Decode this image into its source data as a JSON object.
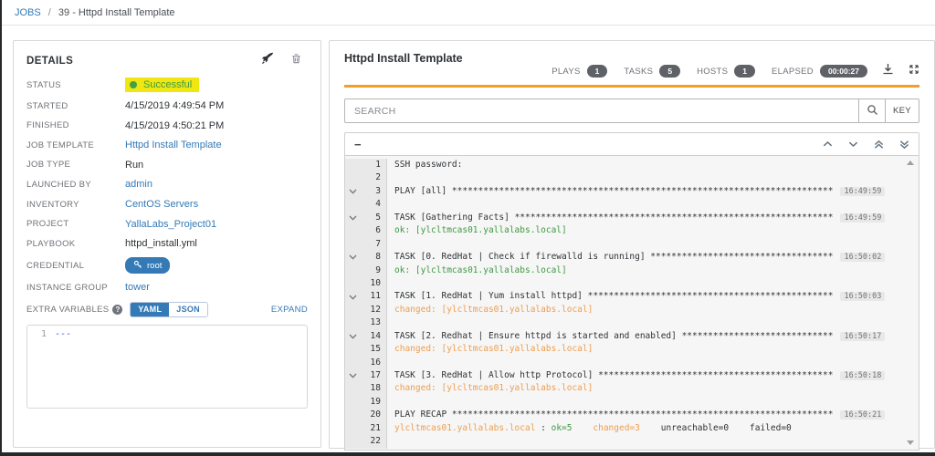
{
  "breadcrumb": {
    "root": "JOBS",
    "separator": "/",
    "current": "39 - Httpd Install Template"
  },
  "details": {
    "title": "DETAILS",
    "rows": [
      {
        "label": "STATUS",
        "value": "Successful",
        "type": "status"
      },
      {
        "label": "STARTED",
        "value": "4/15/2019 4:49:54 PM",
        "type": "text"
      },
      {
        "label": "FINISHED",
        "value": "4/15/2019 4:50:21 PM",
        "type": "text"
      },
      {
        "label": "JOB TEMPLATE",
        "value": "Httpd Install Template",
        "type": "link"
      },
      {
        "label": "JOB TYPE",
        "value": "Run",
        "type": "text"
      },
      {
        "label": "LAUNCHED BY",
        "value": "admin",
        "type": "link"
      },
      {
        "label": "INVENTORY",
        "value": "CentOS Servers",
        "type": "link"
      },
      {
        "label": "PROJECT",
        "value": "YallaLabs_Project01",
        "type": "link"
      },
      {
        "label": "PLAYBOOK",
        "value": "httpd_install.yml",
        "type": "text"
      },
      {
        "label": "CREDENTIAL",
        "value": "root",
        "type": "credential"
      },
      {
        "label": "INSTANCE GROUP",
        "value": "tower",
        "type": "link"
      }
    ],
    "extra_variables": {
      "label": "EXTRA VARIABLES",
      "yaml_label": "YAML",
      "json_label": "JSON",
      "expand_label": "EXPAND",
      "line_number": "1",
      "content": "---"
    }
  },
  "output": {
    "title": "Httpd Install Template",
    "stats": [
      {
        "label": "PLAYS",
        "value": "1"
      },
      {
        "label": "TASKS",
        "value": "5"
      },
      {
        "label": "HOSTS",
        "value": "1"
      },
      {
        "label": "ELAPSED",
        "value": "00:00:27"
      }
    ],
    "search": {
      "placeholder": "SEARCH",
      "key_label": "KEY"
    },
    "toolbar": {
      "collapse_glyph": "−"
    },
    "lines": [
      {
        "n": 1,
        "chev": false,
        "seg": [
          [
            "SSH password:",
            "d"
          ]
        ]
      },
      {
        "n": 2,
        "chev": false,
        "seg": []
      },
      {
        "n": 3,
        "chev": true,
        "seg": [
          [
            "PLAY [all] ",
            "d"
          ]
        ],
        "stars": 73,
        "ts": "16:49:59"
      },
      {
        "n": 4,
        "chev": false,
        "seg": []
      },
      {
        "n": 5,
        "chev": true,
        "seg": [
          [
            "TASK [Gathering Facts] ",
            "d"
          ]
        ],
        "stars": 61,
        "ts": "16:49:59"
      },
      {
        "n": 6,
        "chev": false,
        "seg": [
          [
            "ok: [ylcltmcas01.yallalabs.local]",
            "g"
          ]
        ]
      },
      {
        "n": 7,
        "chev": false,
        "seg": []
      },
      {
        "n": 8,
        "chev": true,
        "seg": [
          [
            "TASK [0. RedHat | Check if firewalld is running] ",
            "d"
          ]
        ],
        "stars": 35,
        "ts": "16:50:02"
      },
      {
        "n": 9,
        "chev": false,
        "seg": [
          [
            "ok: [ylcltmcas01.yallalabs.local]",
            "g"
          ]
        ]
      },
      {
        "n": 10,
        "chev": false,
        "seg": []
      },
      {
        "n": 11,
        "chev": true,
        "seg": [
          [
            "TASK [1. RedHat | Yum install httpd] ",
            "d"
          ]
        ],
        "stars": 47,
        "ts": "16:50:03"
      },
      {
        "n": 12,
        "chev": false,
        "seg": [
          [
            "changed: [ylcltmcas01.yallalabs.local]",
            "o"
          ]
        ]
      },
      {
        "n": 13,
        "chev": false,
        "seg": []
      },
      {
        "n": 14,
        "chev": true,
        "seg": [
          [
            "TASK [2. Redhat | Ensure httpd is started and enabled] ",
            "d"
          ]
        ],
        "stars": 29,
        "ts": "16:50:17"
      },
      {
        "n": 15,
        "chev": false,
        "seg": [
          [
            "changed: [ylcltmcas01.yallalabs.local]",
            "o"
          ]
        ]
      },
      {
        "n": 16,
        "chev": false,
        "seg": []
      },
      {
        "n": 17,
        "chev": true,
        "seg": [
          [
            "TASK [3. RedHat | Allow http Protocol] ",
            "d"
          ]
        ],
        "stars": 45,
        "ts": "16:50:18"
      },
      {
        "n": 18,
        "chev": false,
        "seg": [
          [
            "changed: [ylcltmcas01.yallalabs.local]",
            "o"
          ]
        ]
      },
      {
        "n": 19,
        "chev": false,
        "seg": []
      },
      {
        "n": 20,
        "chev": false,
        "seg": [
          [
            "PLAY RECAP ",
            "d"
          ]
        ],
        "stars": 73,
        "ts": "16:50:21"
      },
      {
        "n": 21,
        "chev": false,
        "seg": [
          [
            "ylcltmcas01.yallalabs.local",
            "o"
          ],
          [
            " : ",
            "d"
          ],
          [
            "ok=5",
            "g"
          ],
          [
            "    ",
            "d"
          ],
          [
            "changed=3",
            "o"
          ],
          [
            "    ",
            "d"
          ],
          [
            "unreachable=0",
            "d"
          ],
          [
            "    ",
            "d"
          ],
          [
            "failed=0",
            "d"
          ]
        ]
      },
      {
        "n": 22,
        "chev": false,
        "seg": []
      }
    ]
  },
  "icons": {
    "help_glyph": "?"
  },
  "colors": {
    "link_blue": "#337ab7",
    "status_green": "#3d9c40",
    "highlight_yellow": "#f0e612",
    "accent_orange": "#f0a029",
    "badge_gray": "#5e6267",
    "console_green": "#3f9943",
    "console_orange": "#ef9e4e"
  }
}
